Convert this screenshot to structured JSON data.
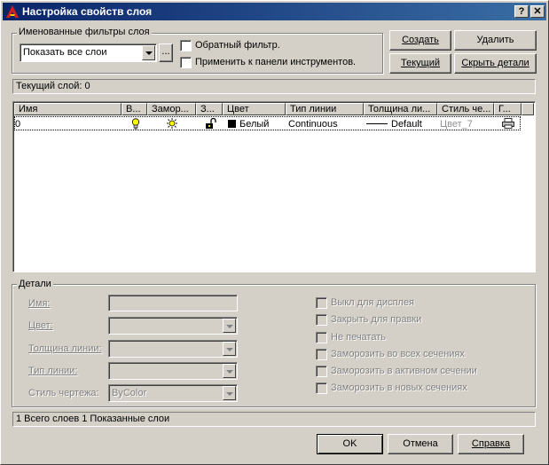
{
  "window": {
    "title": "Настройка свойств слоя"
  },
  "titlebar_buttons": {
    "help": "?",
    "close": "✕"
  },
  "filters": {
    "group_label": "Именованные фильтры слоя",
    "select_value": "Показать все слои",
    "browse_label": "...",
    "invert_label": "Обратный фильтр.",
    "apply_label": "Применить к панели инструментов."
  },
  "buttons": {
    "create": "Создать",
    "delete": "Удалить",
    "current": "Текущий",
    "hide_details": "Скрыть детали",
    "ok": "OK",
    "cancel": "Отмена",
    "help": "Справка"
  },
  "current_layer": "Текущий слой:  0",
  "table": {
    "columns": [
      "Имя",
      "В...",
      "Замор...",
      "З...",
      "Цвет",
      "Тип линии",
      "Толщина ли...",
      "Стиль че...",
      "Г..."
    ],
    "rows": [
      {
        "name": "0",
        "color_name": "Белый",
        "linetype": "Continuous",
        "lineweight": "Default",
        "plotstyle": "Цвет_7"
      }
    ]
  },
  "details": {
    "group_label": "Детали",
    "name_label": "Имя:",
    "color_label": "Цвет:",
    "lineweight_label": "Толщина линии:",
    "linetype_label": "Тип линии:",
    "plotstyle_label": "Стиль чертежа:",
    "plotstyle_value": "ByColor",
    "checks": [
      "Выкл для дисплея",
      "Закрыть для правки",
      "Не печатать",
      "Заморозить во всех сечениях",
      "Заморозить в активном сечении",
      "Заморозить в новых сечениях"
    ]
  },
  "status": "1 Всего слоев   1 Показанные слои"
}
